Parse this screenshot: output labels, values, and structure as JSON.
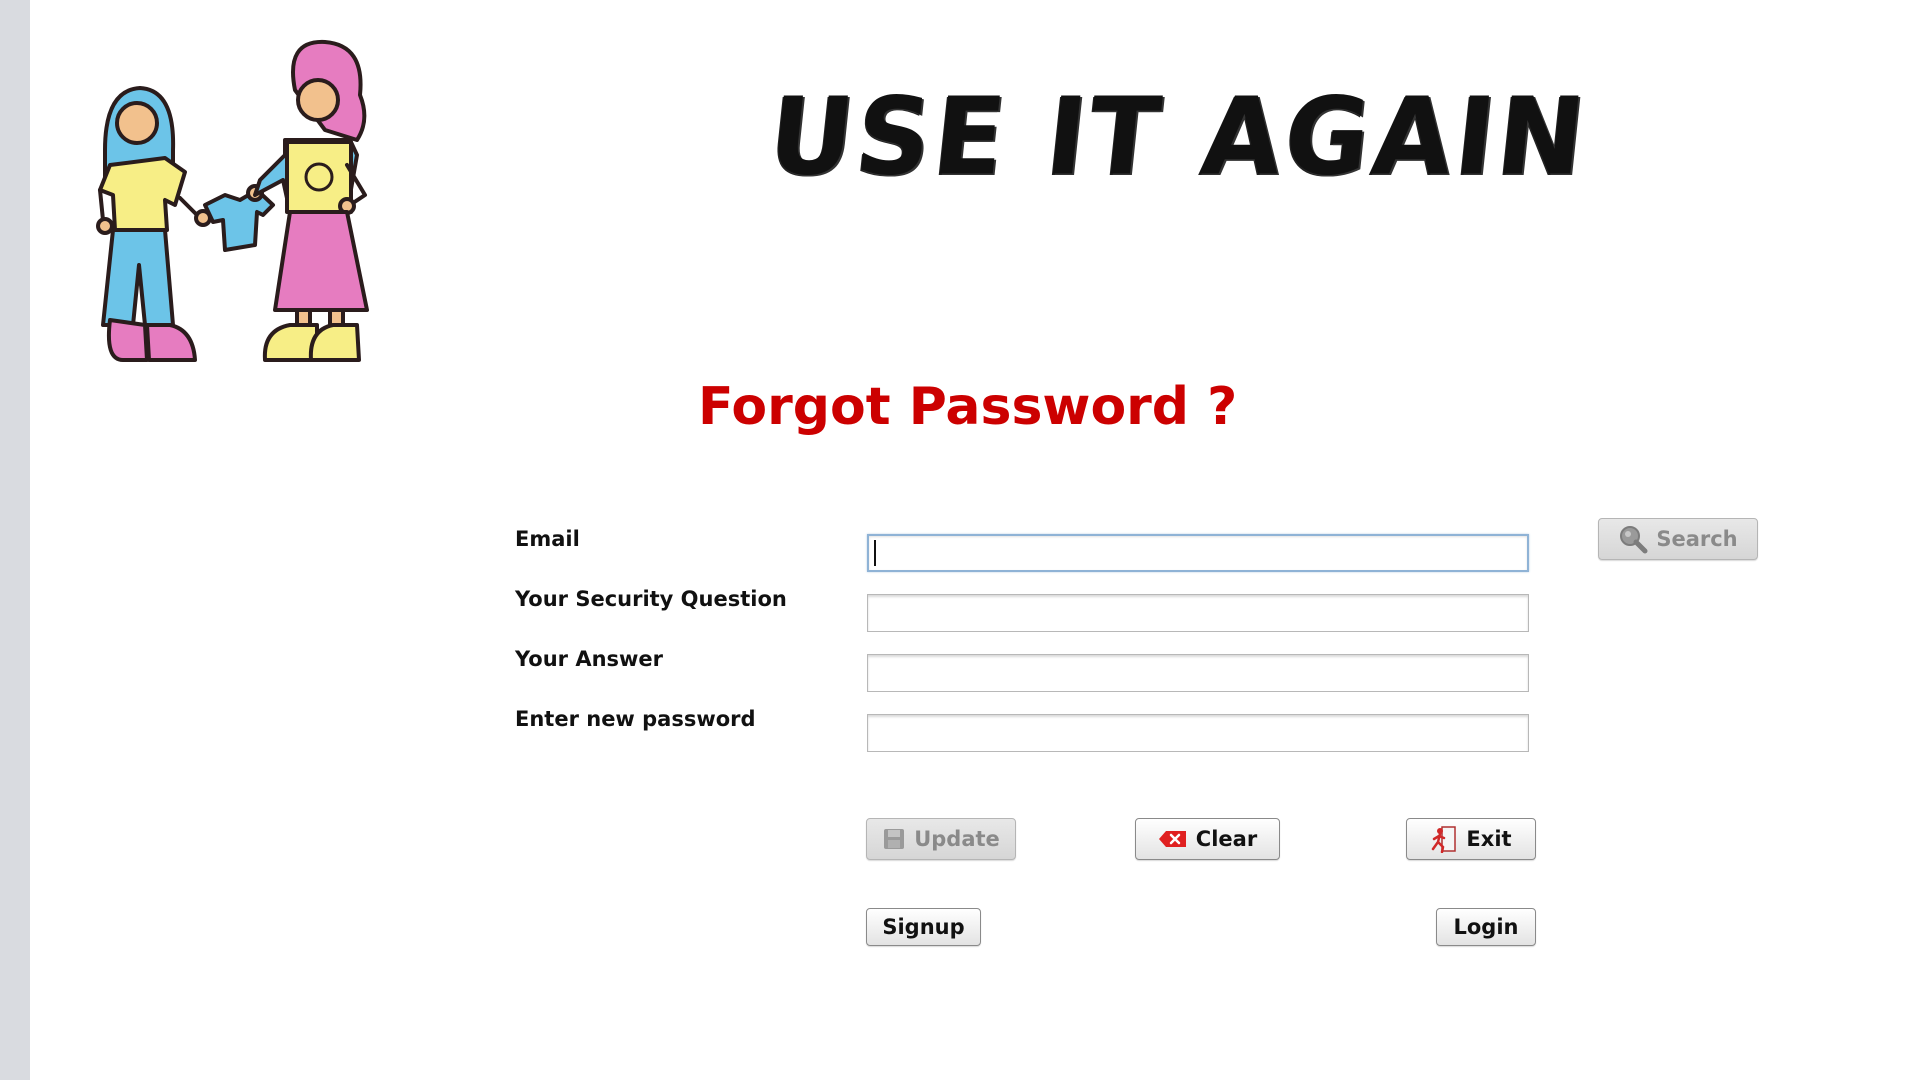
{
  "app": {
    "title": "USE IT AGAIN"
  },
  "page": {
    "heading": "Forgot Password ?"
  },
  "form": {
    "fields": [
      {
        "label": "Email",
        "value": "",
        "focused": true
      },
      {
        "label": "Your Security Question",
        "value": ""
      },
      {
        "label": "Your Answer",
        "value": ""
      },
      {
        "label": "Enter new password",
        "value": ""
      }
    ]
  },
  "buttons": {
    "search": {
      "label": "Search",
      "icon": "magnifier-icon",
      "enabled": false
    },
    "update": {
      "label": "Update",
      "icon": "floppy-disk-icon",
      "enabled": false
    },
    "clear": {
      "label": "Clear",
      "icon": "red-eraser-icon",
      "enabled": true
    },
    "exit": {
      "label": "Exit",
      "icon": "exit-door-icon",
      "enabled": true
    },
    "signup": {
      "label": "Signup",
      "enabled": true
    },
    "login": {
      "label": "Login",
      "enabled": true
    }
  },
  "colors": {
    "heading": "#cc0000",
    "sidebar_strip": "#d9dbe0",
    "focus_border": "#8fb3d6"
  }
}
